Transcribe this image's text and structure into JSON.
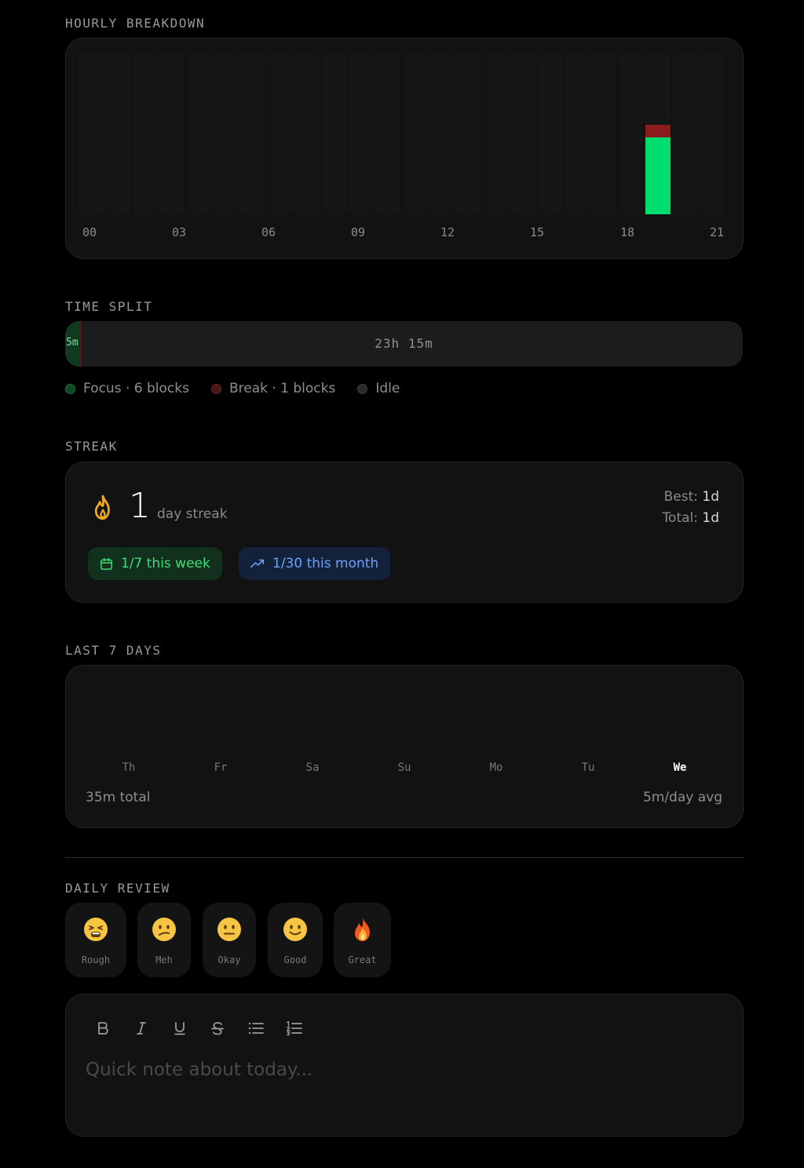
{
  "hourly": {
    "title": "HOURLY BREAKDOWN",
    "hour_labels": [
      "00",
      "03",
      "06",
      "09",
      "12",
      "15",
      "18",
      "21"
    ],
    "chart_data": {
      "type": "bar",
      "stacked": true,
      "categories": [
        "00",
        "01",
        "02",
        "03",
        "04",
        "05",
        "06",
        "07",
        "08",
        "09",
        "10",
        "11",
        "12",
        "13",
        "14",
        "15",
        "16",
        "17",
        "18",
        "19",
        "20",
        "21",
        "22",
        "23"
      ],
      "series": [
        {
          "values": [
            0,
            0,
            0,
            0,
            0,
            0,
            0,
            0,
            0,
            0,
            0,
            0,
            0,
            0,
            0,
            0,
            0,
            0,
            0,
            0,
            0,
            0.48,
            0,
            0
          ],
          "color": "#00dc6e"
        },
        {
          "values": [
            0,
            0,
            0,
            0,
            0,
            0,
            0,
            0,
            0,
            0,
            0,
            0,
            0,
            0,
            0,
            0,
            0,
            0,
            0,
            0,
            0,
            0.08,
            0,
            0
          ],
          "color": "#8b1c1c"
        }
      ],
      "ylim": [
        0,
        1
      ]
    }
  },
  "time_split": {
    "title": "TIME SPLIT",
    "focus_label": "5m",
    "idle_label": "23h 15m",
    "focus_fraction": 0.021,
    "break_fraction": 0.003,
    "legend": [
      {
        "label": "Focus · 6 blocks",
        "color": "#0f4a26"
      },
      {
        "label": "Break · 1 blocks",
        "color": "#4a1616"
      },
      {
        "label": "Idle",
        "color": "#2c2c2c"
      }
    ]
  },
  "streak": {
    "title": "STREAK",
    "icon": "flame-icon",
    "count": "1",
    "label": "day streak",
    "best_label": "Best:",
    "best_value": "1d",
    "total_label": "Total:",
    "total_value": "1d",
    "week_pill": "1/7 this week",
    "month_pill": "1/30 this month",
    "week_color": "#3fdc76",
    "month_color": "#6aa4ff"
  },
  "last7": {
    "title": "LAST 7 DAYS",
    "days": [
      "Th",
      "Fr",
      "Sa",
      "Su",
      "Mo",
      "Tu",
      "We"
    ],
    "active_day": "We",
    "total": "35m total",
    "avg": "5m/day avg"
  },
  "review": {
    "title": "DAILY REVIEW",
    "moods": [
      {
        "label": "Rough",
        "icon": "tired-face-icon"
      },
      {
        "label": "Meh",
        "icon": "confused-face-icon"
      },
      {
        "label": "Okay",
        "icon": "neutral-face-icon"
      },
      {
        "label": "Good",
        "icon": "smiling-face-icon"
      },
      {
        "label": "Great",
        "icon": "fire-icon"
      }
    ],
    "note_placeholder": "Quick note about today..."
  }
}
